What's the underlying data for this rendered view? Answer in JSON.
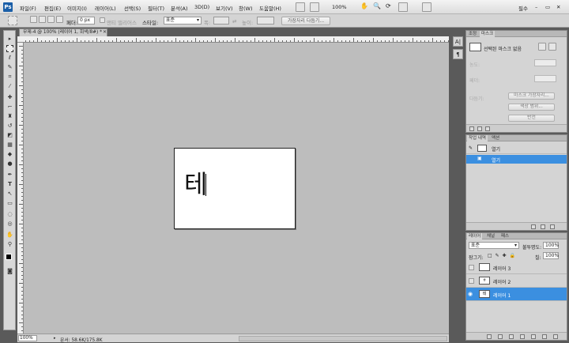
{
  "menubar": {
    "logo": "Ps",
    "items": [
      "파일(F)",
      "편집(E)",
      "이미지(I)",
      "레이어(L)",
      "선택(S)",
      "필터(T)",
      "분석(A)",
      "3D(D)",
      "보기(V)",
      "창(W)",
      "도움말(H)"
    ],
    "zoom_value": "100%",
    "workspace": "필수"
  },
  "options": {
    "feather_label": "페더:",
    "feather_value": "0 px",
    "antialias_label": "앤티 앨리어스",
    "style_label": "스타일:",
    "style_value": "표준",
    "width_label": "폭:",
    "height_label": "높이:",
    "refine_button": "가장자리 다듬기..."
  },
  "document": {
    "tab_title": "무제-4 @ 100% (레이어 1, 회색/8#) *",
    "canvas_text": "테",
    "zoom_status": "100%",
    "doc_size": "문서: 58.6K/175.8K"
  },
  "vstrip": {
    "btn1": "A|",
    "btn2": "¶"
  },
  "masks_panel": {
    "tabs": [
      "조정",
      "마스크"
    ],
    "selected_text": "선택된 마스크 없음",
    "density_label": "농도:",
    "feather_label": "페더:",
    "refine_label": "다듬기:",
    "btn_mask_edge": "마스크 가장자리...",
    "btn_color_range": "색상 범위...",
    "btn_invert": "반전"
  },
  "history_panel": {
    "tabs": [
      "작업 내역",
      "액션"
    ],
    "doc_name": "열기",
    "step": "열기"
  },
  "layers_panel": {
    "tabs": [
      "레이어",
      "채널",
      "패스"
    ],
    "blend_mode": "표준",
    "opacity_label": "불투명도:",
    "opacity_value": "100%",
    "lock_label": "잠그기:",
    "fill_label": "칠:",
    "fill_value": "100%",
    "layers": [
      {
        "name": "레이어 3",
        "selected": false,
        "visible": false,
        "thumb": ""
      },
      {
        "name": "레이어 2",
        "selected": false,
        "visible": false,
        "thumb": "ㅎ"
      },
      {
        "name": "레이어 1",
        "selected": true,
        "visible": true,
        "thumb": "테"
      }
    ]
  },
  "colors": {
    "accent": "#3b8fe0",
    "logo": "#1b5fa8"
  }
}
